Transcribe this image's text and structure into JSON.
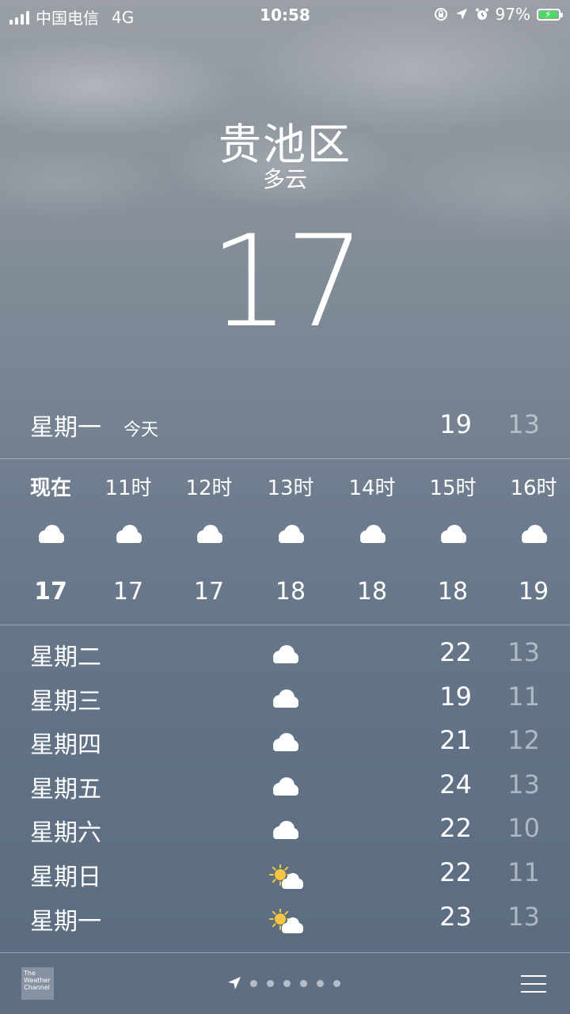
{
  "status_bar": {
    "carrier": "中国电信",
    "network": "4G",
    "time": "10:58",
    "battery_percent": "97%",
    "battery_level": 0.97,
    "icons": [
      "signal-icon",
      "rotation-lock-icon",
      "location-arrow-icon",
      "alarm-icon",
      "battery-charging-icon"
    ]
  },
  "header": {
    "city": "贵池区",
    "condition": "多云",
    "temperature": "17"
  },
  "today": {
    "day": "星期一",
    "label": "今天",
    "high": "19",
    "low": "13"
  },
  "hourly": [
    {
      "time": "现在",
      "icon": "cloud-icon",
      "temp": "17"
    },
    {
      "time": "11时",
      "icon": "cloud-icon",
      "temp": "17"
    },
    {
      "time": "12时",
      "icon": "cloud-icon",
      "temp": "17"
    },
    {
      "time": "13时",
      "icon": "cloud-icon",
      "temp": "18"
    },
    {
      "time": "14时",
      "icon": "cloud-icon",
      "temp": "18"
    },
    {
      "time": "15时",
      "icon": "cloud-icon",
      "temp": "18"
    },
    {
      "time": "16时",
      "icon": "cloud-icon",
      "temp": "19"
    }
  ],
  "daily": [
    {
      "day": "星期二",
      "icon": "cloud-icon",
      "high": "22",
      "low": "13"
    },
    {
      "day": "星期三",
      "icon": "cloud-icon",
      "high": "19",
      "low": "11"
    },
    {
      "day": "星期四",
      "icon": "cloud-icon",
      "high": "21",
      "low": "12"
    },
    {
      "day": "星期五",
      "icon": "cloud-icon",
      "high": "24",
      "low": "13"
    },
    {
      "day": "星期六",
      "icon": "cloud-icon",
      "high": "22",
      "low": "10"
    },
    {
      "day": "星期日",
      "icon": "partly-sunny-icon",
      "high": "22",
      "low": "11"
    },
    {
      "day": "星期一",
      "icon": "partly-sunny-icon",
      "high": "23",
      "low": "13"
    }
  ],
  "bottom_bar": {
    "logo_text": "The Weather Channel",
    "page_dots": 6,
    "icons": [
      "weather-channel-logo-icon",
      "location-arrow-icon",
      "list-icon"
    ]
  },
  "colors": {
    "battery_fill": "#4cd964",
    "text": "#ffffff",
    "low_temp": "rgba(255,255,255,0.5)",
    "sun": "#f5c542"
  }
}
